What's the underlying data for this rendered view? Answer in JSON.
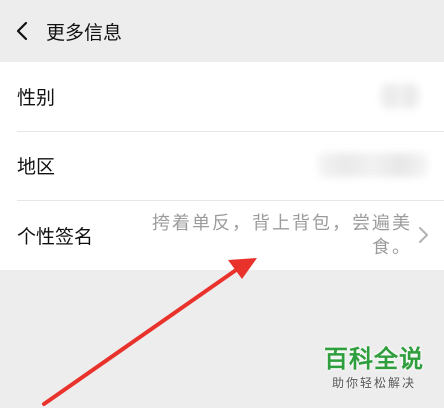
{
  "header": {
    "title": "更多信息",
    "back_icon": "chevron-left-icon"
  },
  "rows": [
    {
      "label": "性别"
    },
    {
      "label": "地区"
    },
    {
      "label": "个性签名",
      "value": "挎着单反，背上背包，尝遍美食。",
      "chevron_icon": "chevron-right-icon"
    }
  ],
  "annotation": {
    "arrow_color": "#e8322b"
  },
  "watermark": {
    "main": "百科全说",
    "sub": "助你轻松解决",
    "color": "#2f9e3d"
  }
}
